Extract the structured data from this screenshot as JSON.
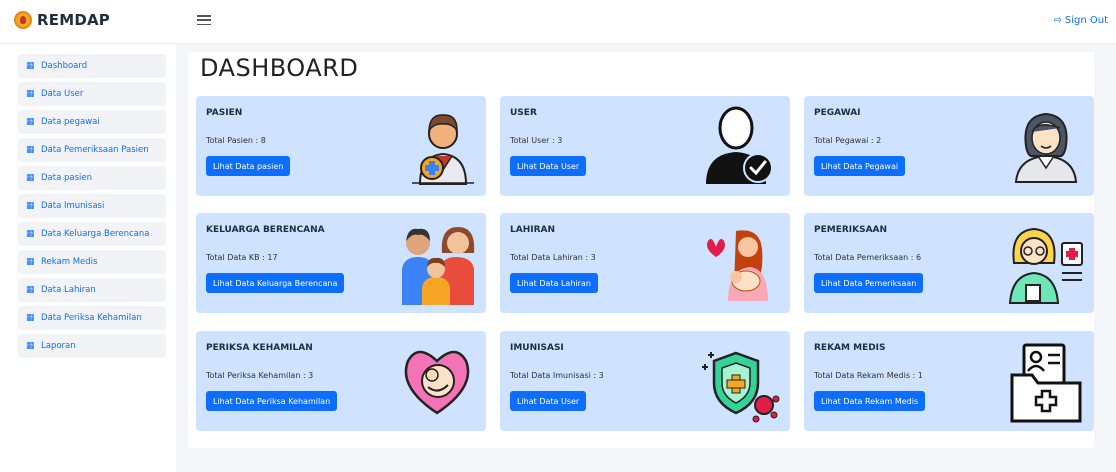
{
  "app": {
    "brand": "REMDAP"
  },
  "topbar": {
    "signout_label": "Sign Out"
  },
  "sidebar": {
    "items": [
      {
        "label": "Dashboard"
      },
      {
        "label": "Data User"
      },
      {
        "label": "Data pegawai"
      },
      {
        "label": "Data Pemeriksaan Pasien"
      },
      {
        "label": "Data pasien"
      },
      {
        "label": "Data Imunisasi"
      },
      {
        "label": "Data Keluarga Berencana"
      },
      {
        "label": "Rekam Medis"
      },
      {
        "label": "Data Lahiran"
      },
      {
        "label": "Data Periksa Kehamilan"
      },
      {
        "label": "Laporan"
      }
    ]
  },
  "main": {
    "title": "DASHBOARD",
    "cards": [
      {
        "title": "PASIEN",
        "text": "Total Pasien : 8",
        "button": "Lihat Data pasien",
        "icon": "doctor-icon"
      },
      {
        "title": "USER",
        "text": "Total User : 3",
        "button": "Lihat Data User",
        "icon": "user-check-icon"
      },
      {
        "title": "PEGAWAI",
        "text": "Total Pegawai : 2",
        "button": "Lihat Data Pegawai",
        "icon": "employee-icon"
      },
      {
        "title": "KELUARGA BERENCANA",
        "text": "Total Data KB : 17",
        "button": "Lihat Data Keluarga Berencana",
        "icon": "family-icon"
      },
      {
        "title": "LAHIRAN",
        "text": "Total Data Lahiran : 3",
        "button": "Lihat Data Lahiran",
        "icon": "mother-baby-icon"
      },
      {
        "title": "PEMERIKSAAN",
        "text": "Total Data Pemeriksaan : 6",
        "button": "Lihat Data Pemeriksaan",
        "icon": "doctor-examination-icon"
      },
      {
        "title": "PERIKSA KEHAMILAN",
        "text": "Total Periksa Kehamilan : 3",
        "button": "Lihat Data Periksa Kehamilan",
        "icon": "pregnancy-heart-icon"
      },
      {
        "title": "IMUNISASI",
        "text": "Total Data Imunisasi : 3",
        "button": "Lihat Data User",
        "icon": "vaccine-shield-icon"
      },
      {
        "title": "REKAM MEDIS",
        "text": "Total Data Rekam Medis : 1",
        "button": "Lihat Data Rekam Medis",
        "icon": "medical-record-icon"
      }
    ]
  },
  "colors": {
    "accent": "#0d6efd",
    "card_bg": "#cfe2ff"
  }
}
